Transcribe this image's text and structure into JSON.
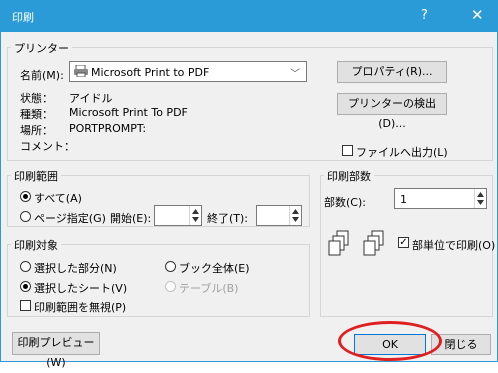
{
  "title": "印刷",
  "titlebar": {
    "help": "?",
    "close": "✕"
  },
  "printer": {
    "group_label": "プリンター",
    "name_label": "名前(M):",
    "name_value": "Microsoft Print to PDF",
    "status_label": "状態：",
    "status_value": "アイドル",
    "type_label": "種類：",
    "type_value": "Microsoft Print To PDF",
    "location_label": "場所：",
    "location_value": "PORTPROMPT:",
    "comment_label": "コメント：",
    "properties_button": "プロパティ(R)...",
    "find_printer_button": "プリンターの検出(D)...",
    "print_to_file": "ファイルへ出力(L)"
  },
  "range": {
    "group_label": "印刷範囲",
    "all": "すべて(A)",
    "pages": "ページ指定(G)",
    "start_label": "開始(E):",
    "end_label": "終了(T):"
  },
  "copies": {
    "group_label": "印刷部数",
    "count_label": "部数(C):",
    "count_value": "1",
    "collate": "部単位で印刷(O)"
  },
  "target": {
    "group_label": "印刷対象",
    "selection_part": "選択した部分(N)",
    "whole_book": "ブック全体(E)",
    "selected_sheets": "選択したシート(V)",
    "table": "テーブル(B)",
    "ignore_print_area": "印刷範囲を無視(P)"
  },
  "buttons": {
    "preview": "印刷プレビュー(W)",
    "ok": "OK",
    "close": "閉じる"
  },
  "highlight_color": "#e02020"
}
